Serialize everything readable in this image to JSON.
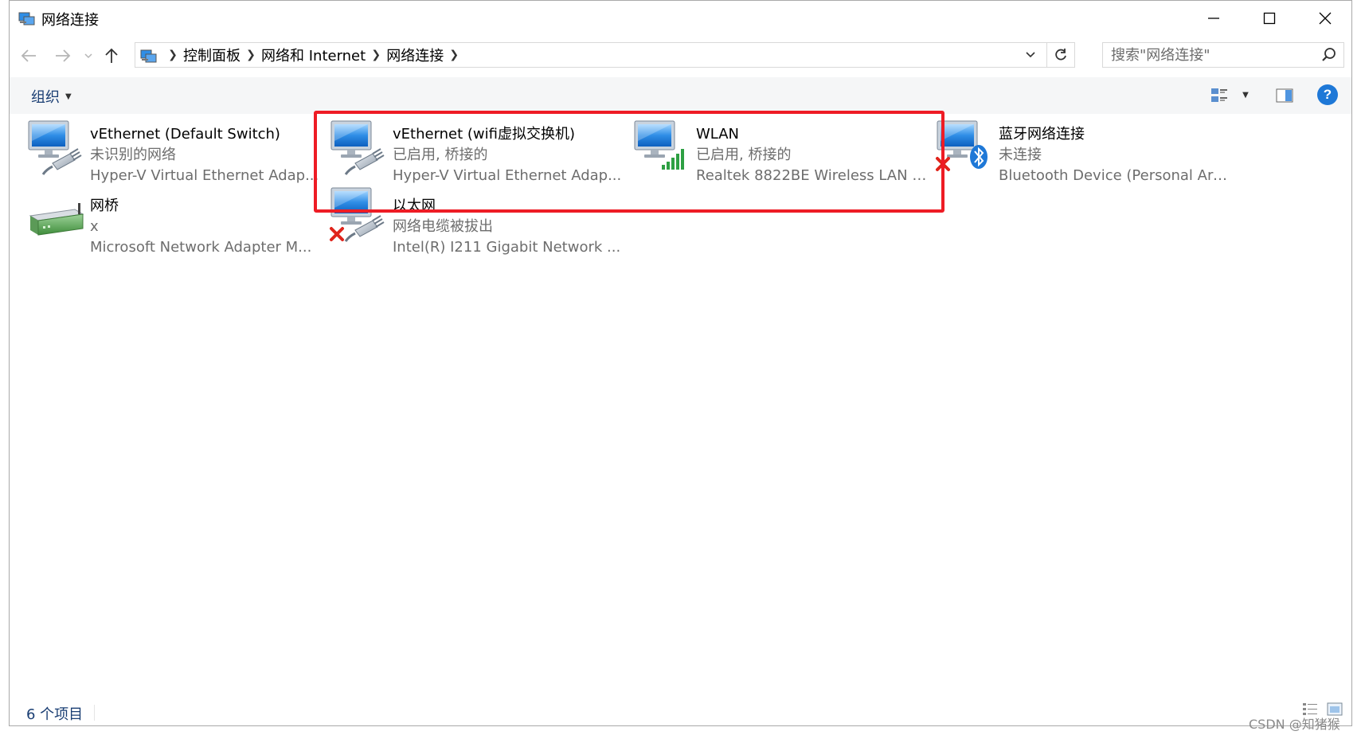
{
  "window": {
    "title": "网络连接"
  },
  "address": {
    "crumbs": [
      "控制面板",
      "网络和 Internet",
      "网络连接"
    ]
  },
  "search": {
    "placeholder": "搜索\"网络连接\""
  },
  "toolbar": {
    "organize_label": "组织",
    "help_label": "?"
  },
  "items": [
    {
      "name": "vEthernet (Default Switch)",
      "status": "未识别的网络",
      "device": "Hyper-V Virtual Ethernet Adap...",
      "icon": "ethernet-adapter-icon"
    },
    {
      "name": "vEthernet (wifi虚拟交换机)",
      "status": "已启用, 桥接的",
      "device": "Hyper-V Virtual Ethernet Adap...",
      "icon": "ethernet-adapter-icon"
    },
    {
      "name": "WLAN",
      "status": "已启用, 桥接的",
      "device": "Realtek 8822BE Wireless LAN 8...",
      "icon": "wifi-adapter-icon"
    },
    {
      "name": "蓝牙网络连接",
      "status": "未连接",
      "device": "Bluetooth Device (Personal Are...",
      "icon": "bluetooth-adapter-icon"
    },
    {
      "name": "网桥",
      "status": "x",
      "device": "Microsoft Network Adapter M...",
      "icon": "network-bridge-icon"
    },
    {
      "name": "以太网",
      "status": "网络电缆被拔出",
      "device": "Intel(R) I211 Gigabit Network ...",
      "icon": "ethernet-adapter-icon"
    }
  ],
  "statusbar": {
    "count": "6 个项目"
  },
  "watermark": "CSDN @知猪猴",
  "colors": {
    "highlight": "#ee1c25",
    "accent_text": "#1a3e73",
    "help_blue": "#1e78d7"
  }
}
